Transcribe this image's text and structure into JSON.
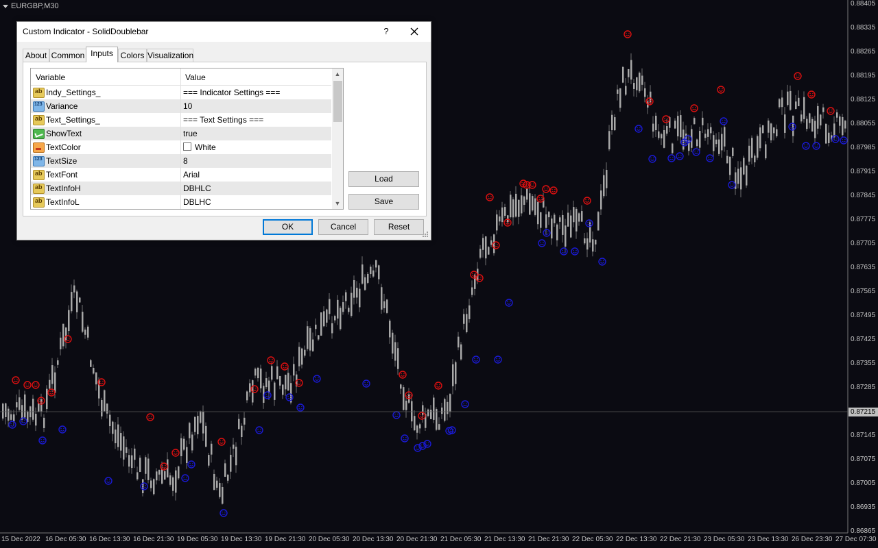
{
  "chart": {
    "symbol": "EURGBP,M30",
    "current_price": "0.87215",
    "price_axis": [
      "0.88405",
      "0.88335",
      "0.88265",
      "0.88195",
      "0.88125",
      "0.88055",
      "0.87985",
      "0.87915",
      "0.87845",
      "0.87775",
      "0.87705",
      "0.87635",
      "0.87565",
      "0.87495",
      "0.87425",
      "0.87355",
      "0.87285",
      "0.87215",
      "0.87145",
      "0.87075",
      "0.87005",
      "0.86935",
      "0.86865"
    ],
    "time_axis": [
      "15 Dec 2022",
      "16 Dec 05:30",
      "16 Dec 13:30",
      "16 Dec 21:30",
      "19 Dec 05:30",
      "19 Dec 13:30",
      "19 Dec 21:30",
      "20 Dec 05:30",
      "20 Dec 13:30",
      "20 Dec 21:30",
      "21 Dec 05:30",
      "21 Dec 13:30",
      "21 Dec 21:30",
      "22 Dec 05:30",
      "22 Dec 13:30",
      "22 Dec 21:30",
      "23 Dec 05:30",
      "23 Dec 13:30",
      "26 Dec 23:30",
      "27 Dec 07:30"
    ],
    "colors": {
      "background": "#0b0b12",
      "candle": "#a8a8a8",
      "sell_marker": "#e01010",
      "buy_marker": "#1a1ad6"
    }
  },
  "dialog": {
    "title": "Custom Indicator - SolidDoublebar",
    "help_label": "?",
    "close_icon": "close-icon",
    "tabs": [
      {
        "label": "About"
      },
      {
        "label": "Common"
      },
      {
        "label": "Inputs"
      },
      {
        "label": "Colors"
      },
      {
        "label": "Visualization"
      }
    ],
    "active_tab": "Inputs",
    "grid": {
      "col_variable": "Variable",
      "col_value": "Value",
      "rows": [
        {
          "icon": "string-icon",
          "name": "Indy_Settings_",
          "value": " === Indicator Settings ==="
        },
        {
          "icon": "number-icon",
          "name": "Variance",
          "value": "10"
        },
        {
          "icon": "string-icon",
          "name": "Text_Settings_",
          "value": " === Text Settings ==="
        },
        {
          "icon": "bool-icon",
          "name": "ShowText",
          "value": "true"
        },
        {
          "icon": "color-icon",
          "name": "TextColor",
          "value": "White"
        },
        {
          "icon": "number-icon",
          "name": "TextSize",
          "value": "8"
        },
        {
          "icon": "string-icon",
          "name": "TextFont",
          "value": "Arial"
        },
        {
          "icon": "string-icon",
          "name": "TextInfoH",
          "value": "DBHLC"
        },
        {
          "icon": "string-icon",
          "name": "TextInfoL",
          "value": "DBLHC"
        }
      ]
    },
    "buttons": {
      "load": "Load",
      "save": "Save",
      "ok": "OK",
      "cancel": "Cancel",
      "reset": "Reset"
    }
  }
}
